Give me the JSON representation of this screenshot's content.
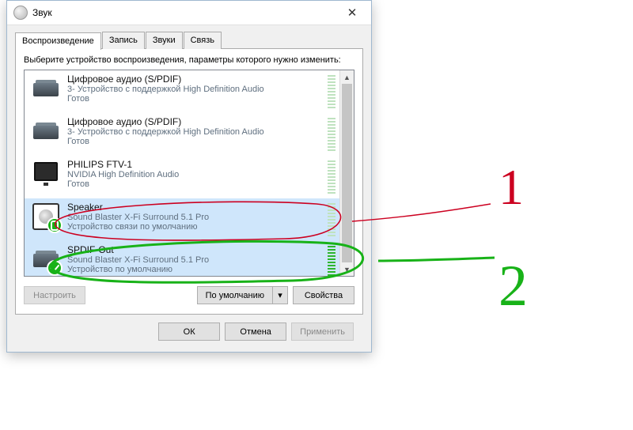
{
  "window": {
    "title": "Звук"
  },
  "tabs": {
    "playback": "Воспроизведение",
    "recording": "Запись",
    "sounds": "Звуки",
    "communications": "Связь"
  },
  "instruction": "Выберите устройство воспроизведения, параметры которого нужно изменить:",
  "devices": [
    {
      "name": "Цифровое аудио (S/PDIF)",
      "sub": "3- Устройство с поддержкой High Definition Audio",
      "status": "Готов",
      "icon": "receiver",
      "selected": false,
      "meter": "idle",
      "badge": null
    },
    {
      "name": "Цифровое аудио (S/PDIF)",
      "sub": "3- Устройство с поддержкой High Definition Audio",
      "status": "Готов",
      "icon": "receiver",
      "selected": false,
      "meter": "idle",
      "badge": null
    },
    {
      "name": "PHILIPS FTV-1",
      "sub": "NVIDIA High Definition Audio",
      "status": "Готов",
      "icon": "monitor",
      "selected": false,
      "meter": "idle",
      "badge": null
    },
    {
      "name": "Speaker",
      "sub": "Sound Blaster X-Fi Surround 5.1 Pro",
      "status": "Устройство связи по умолчанию",
      "icon": "speaker",
      "selected": true,
      "meter": "idle",
      "badge": "phone"
    },
    {
      "name": "SPDIF-Out",
      "sub": "Sound Blaster X-Fi Surround 5.1 Pro",
      "status": "Устройство по умолчанию",
      "icon": "receiver",
      "selected": true,
      "meter": "active",
      "badge": "check"
    }
  ],
  "buttons": {
    "configure": "Настроить",
    "default": "По умолчанию",
    "properties": "Свойства",
    "ok": "ОК",
    "cancel": "Отмена",
    "apply": "Применить"
  },
  "annotations": {
    "label1": "1",
    "label2": "2",
    "color1": "#cc0020",
    "color2": "#18b218"
  }
}
